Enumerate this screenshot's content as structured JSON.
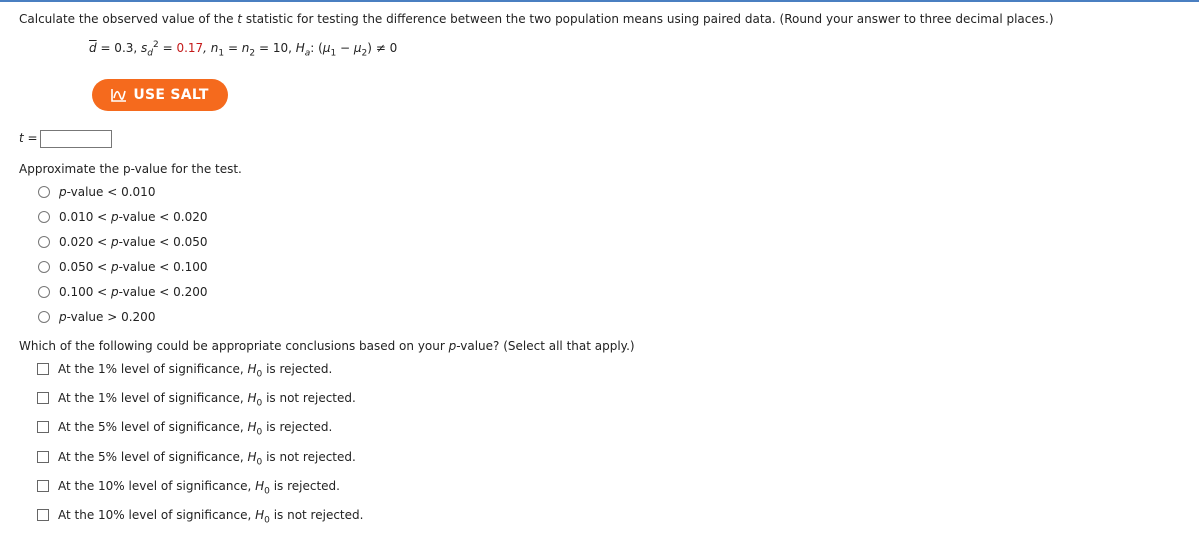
{
  "question1": {
    "text_before_t": "Calculate the observed value of the ",
    "t_symbol": "t",
    "text_after_t": " statistic for testing the difference between the two population means using paired data. (Round your answer to three decimal places.)"
  },
  "formula": {
    "dbar_symbol": "d",
    "dbar_eq": " = 0.3, ",
    "s_symbol": "s",
    "s_sub": "d",
    "s_sup": "2",
    "s_eq": " = ",
    "s_value": "0.17",
    "n1_symbol": ", n",
    "n1_sub": "1",
    "n2_text": " = n",
    "n2_sub": "2",
    "n_eq": " = 10, ",
    "ha_symbol": "H",
    "ha_sub": "a",
    "ha_colon": ": (",
    "mu1": "μ",
    "mu1_sub": "1",
    "minus": " − ",
    "mu2": "μ",
    "mu2_sub": "2",
    "ha_tail": ") ≠ 0"
  },
  "salt_button": {
    "label": "USE SALT"
  },
  "answer": {
    "t_label": "t",
    "eq": " =",
    "value": ""
  },
  "question2": {
    "text": "Approximate the p-value for the test.",
    "options": [
      {
        "pre": "",
        "p": "p",
        "post": "-value < 0.010"
      },
      {
        "pre": "0.010 < ",
        "p": "p",
        "post": "-value < 0.020"
      },
      {
        "pre": "0.020 < ",
        "p": "p",
        "post": "-value < 0.050"
      },
      {
        "pre": "0.050 < ",
        "p": "p",
        "post": "-value < 0.100"
      },
      {
        "pre": "0.100 < ",
        "p": "p",
        "post": "-value < 0.200"
      },
      {
        "pre": "",
        "p": "p",
        "post": "-value > 0.200"
      }
    ]
  },
  "question3": {
    "text_before_p": "Which of the following could be appropriate conclusions based on your ",
    "p_symbol": "p",
    "text_after_p": "-value? (Select all that apply.)",
    "options": [
      {
        "pre": "At the 1% level of significance, ",
        "h": "H",
        "sub": "0",
        "post": " is rejected."
      },
      {
        "pre": "At the 1% level of significance, ",
        "h": "H",
        "sub": "0",
        "post": " is not rejected."
      },
      {
        "pre": "At the 5% level of significance, ",
        "h": "H",
        "sub": "0",
        "post": " is rejected."
      },
      {
        "pre": "At the 5% level of significance, ",
        "h": "H",
        "sub": "0",
        "post": " is not rejected."
      },
      {
        "pre": "At the 10% level of significance, ",
        "h": "H",
        "sub": "0",
        "post": " is rejected."
      },
      {
        "pre": "At the 10% level of significance, ",
        "h": "H",
        "sub": "0",
        "post": " is not rejected."
      }
    ]
  },
  "colors": {
    "accent_orange": "#f56a1d",
    "value_red": "#c41a1a",
    "top_border": "#4a7fc1"
  },
  "icons": {
    "salt": "chart-line-icon"
  }
}
